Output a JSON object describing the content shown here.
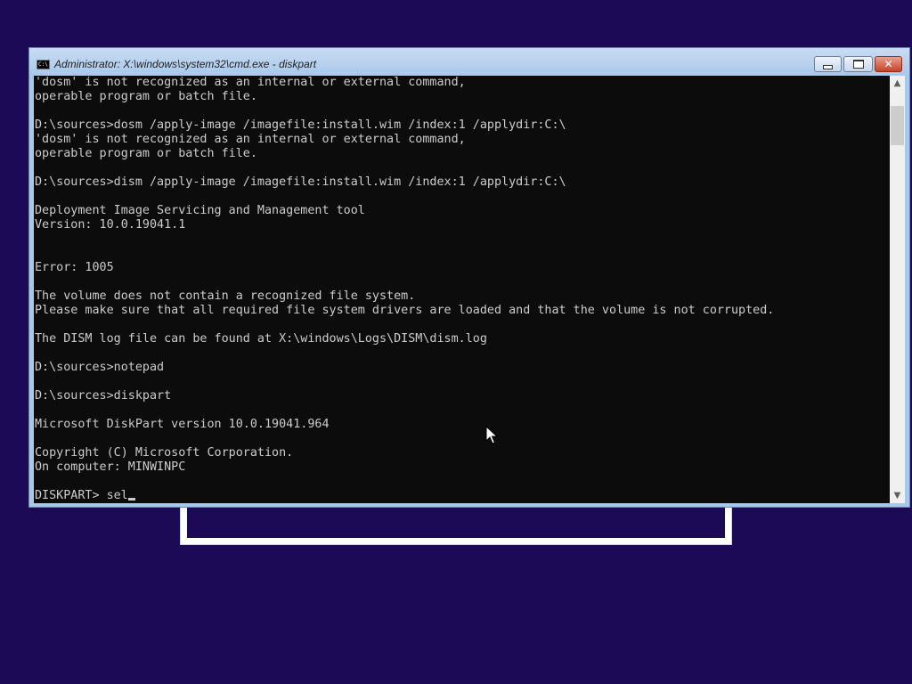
{
  "window": {
    "title": "Administrator: X:\\windows\\system32\\cmd.exe - diskpart",
    "app_icon_text": "C:\\",
    "controls": {
      "minimize": "minimize-icon",
      "maximize": "maximize-icon",
      "close": "close-icon"
    }
  },
  "console": {
    "lines": [
      "'dosm' is not recognized as an internal or external command,",
      "operable program or batch file.",
      "",
      "D:\\sources>dosm /apply-image /imagefile:install.wim /index:1 /applydir:C:\\",
      "'dosm' is not recognized as an internal or external command,",
      "operable program or batch file.",
      "",
      "D:\\sources>dism /apply-image /imagefile:install.wim /index:1 /applydir:C:\\",
      "",
      "Deployment Image Servicing and Management tool",
      "Version: 10.0.19041.1",
      "",
      "",
      "Error: 1005",
      "",
      "The volume does not contain a recognized file system.",
      "Please make sure that all required file system drivers are loaded and that the volume is not corrupted.",
      "",
      "The DISM log file can be found at X:\\windows\\Logs\\DISM\\dism.log",
      "",
      "D:\\sources>notepad",
      "",
      "D:\\sources>diskpart",
      "",
      "Microsoft DiskPart version 10.0.19041.964",
      "",
      "Copyright (C) Microsoft Corporation.",
      "On computer: MINWINPC",
      ""
    ],
    "prompt": "DISKPART> ",
    "input": "sel"
  },
  "scrollbar": {
    "up_icon": "chevron-up-icon",
    "down_icon": "chevron-down-icon"
  },
  "colors": {
    "desktop_background": "#1c0a56",
    "console_background": "#0c0c0c",
    "console_text": "#cccccc",
    "title_bar": "#a9c7ea",
    "close_button": "#c4432a"
  }
}
